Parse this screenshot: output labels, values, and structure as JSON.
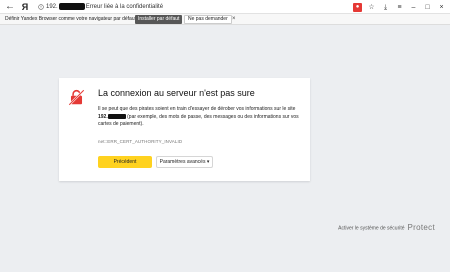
{
  "browser": {
    "back_glyph": "←",
    "logo": "Я",
    "url_host": "192.",
    "url_text": "Erreur liée à la confidentialité",
    "icons": [
      "extensions-icon",
      "downloads-icon",
      "menu-icon",
      "minimize-icon",
      "maximize-icon",
      "close-icon"
    ]
  },
  "default_bar": {
    "message": "Définir Yandex Browser comme votre navigateur par défaut ?",
    "install_label": "Installer par défaut",
    "no_label": "Ne pas demander",
    "close_glyph": "×"
  },
  "error": {
    "title": "La connexion au serveur n'est pas sure",
    "desc_pre": "Il se peut que des pirates soient en train d'essayer de dérober vos informations sur le site",
    "site": "192.",
    "desc_post": "(par exemple, des mots de passe, des messages ou des informations sur vos cartes de paiement).",
    "code": "net::ERR_CERT_AUTHORITY_INVALID",
    "back_label": "Précédent",
    "advanced_label": "Paramètres avancés ▾",
    "accent": "#ffd21f",
    "icon_color": "#e53935"
  },
  "protect": {
    "text": "Activer le système de sécurité",
    "brand": "Protect"
  }
}
